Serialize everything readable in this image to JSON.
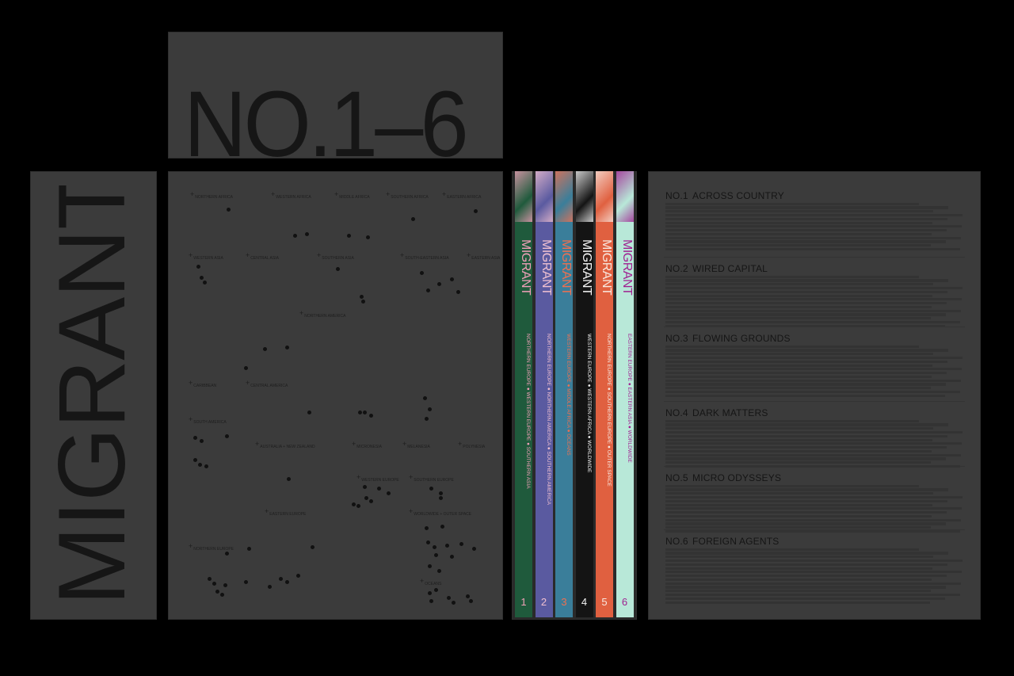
{
  "sleeve_title": "NO.1–6",
  "spine_title": "MIGRANT",
  "map_regions": [
    "NORTHERN AFRICA",
    "WESTERN AFRICA",
    "MIDDLE AFRICA",
    "SOUTHERN AFRICA",
    "EASTERN AFRICA",
    "WESTERN ASIA",
    "CENTRAL ASIA",
    "SOUTHERN ASIA",
    "SOUTH-EASTERN ASIA",
    "EASTERN ASIA",
    "NORTHERN AMERICA",
    "CARIBBEAN",
    "CENTRAL AMERICA",
    "SOUTH AMERICA",
    "AUSTRALIA + NEW ZEALAND",
    "MICRONESIA",
    "MELANESIA",
    "POLYNESIA",
    "WESTERN EUROPE",
    "SOUTHERN EUROPE",
    "EASTERN EUROPE",
    "WORLDWIDE + OUTER SPACE",
    "NORTHERN EUROPE",
    "OCEANS"
  ],
  "books": [
    {
      "num": "1",
      "title": "MIGRANT",
      "regions": "NORTHERN EUROPE ● WESTERN EUROPE ● SOUTHERN ASIA",
      "color": "#1f5a3c",
      "text": "#f0a0b8"
    },
    {
      "num": "2",
      "title": "MIGRANT",
      "regions": "NORTHERN EUROPE ● NORTHERN AMERICA ● SOUTHERN AMERICA",
      "color": "#5a5aa0",
      "text": "#f0c0d0"
    },
    {
      "num": "3",
      "title": "MIGRANT",
      "regions": "WESTERN EUROPE ● MIDDLE AFRICA ● OCEANS",
      "color": "#3a7e9a",
      "text": "#f07050"
    },
    {
      "num": "4",
      "title": "MIGRANT",
      "regions": "WESTERN EUROPE ● WESTERN AFRICA ● WORLDWIDE",
      "color": "#141414",
      "text": "#f5f5f5"
    },
    {
      "num": "5",
      "title": "MIGRANT",
      "regions": "NORTHERN EUROPE ● SOUTHERN EUROPE ● OUTER SPACE",
      "color": "#e06040",
      "text": "#f8e8e0"
    },
    {
      "num": "6",
      "title": "MIGRANT",
      "regions": "EASTERN EUROPE ● EASTERN ASIA ● WORLDWIDE",
      "color": "#b8e8d8",
      "text": "#a02090"
    }
  ],
  "toc": [
    {
      "no": "NO.1",
      "title": "ACROSS COUNTRY",
      "rows": 13
    },
    {
      "no": "NO.2",
      "title": "WIRED CAPITAL",
      "rows": 14
    },
    {
      "no": "NO.3",
      "title": "FLOWING GROUNDS",
      "rows": 14
    },
    {
      "no": "NO.4",
      "title": "DARK MATTERS",
      "rows": 13
    },
    {
      "no": "NO.5",
      "title": "MICRO ODYSSEYS",
      "rows": 13
    },
    {
      "no": "NO.6",
      "title": "FOREIGN AGENTS",
      "rows": 15
    }
  ],
  "colors": {
    "background": "#000000",
    "panel": "#3b3b3b",
    "ink": "#161616"
  }
}
